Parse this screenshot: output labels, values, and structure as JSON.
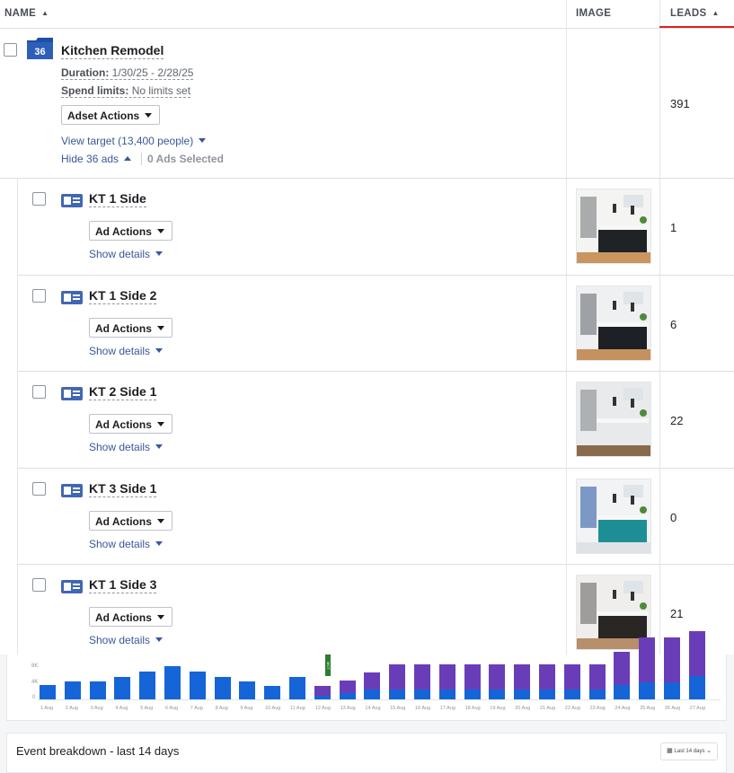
{
  "columns": {
    "name": "NAME",
    "image": "IMAGE",
    "leads": "LEADS"
  },
  "adset": {
    "calendar_day": "36",
    "name": "Kitchen Remodel",
    "duration_label": "Duration:",
    "duration_value": "1/30/25 - 2/28/25",
    "spend_label": "Spend limits:",
    "spend_value": "No limits set",
    "actions_label": "Adset Actions",
    "view_target": "View target (13,400 people)",
    "hide_ads": "Hide 36 ads",
    "selected": "0 Ads Selected",
    "leads": "391"
  },
  "ads": [
    {
      "name": "KT 1 Side",
      "actions_label": "Ad Actions",
      "details_label": "Show details",
      "leads": "1"
    },
    {
      "name": "KT 1 Side 2",
      "actions_label": "Ad Actions",
      "details_label": "Show details",
      "leads": "6"
    },
    {
      "name": "KT 2 Side 1",
      "actions_label": "Ad Actions",
      "details_label": "Show details",
      "leads": "22"
    },
    {
      "name": "KT 3 Side 1",
      "actions_label": "Ad Actions",
      "details_label": "Show details",
      "leads": "0"
    },
    {
      "name": "KT 1 Side 3",
      "actions_label": "Ad Actions",
      "details_label": "Show details",
      "leads": "21"
    }
  ],
  "chart": {
    "colors": {
      "primary": "#1565d8",
      "secondary": "#6a3db8"
    },
    "y_ticks": [
      "8K",
      "4K",
      "0"
    ],
    "x_labels": [
      "1 Aug",
      "2 Aug",
      "3 Aug",
      "4 Aug",
      "5 Aug",
      "6 Aug",
      "7 Aug",
      "8 Aug",
      "9 Aug",
      "10 Aug",
      "11 Aug",
      "12 Aug",
      "13 Aug",
      "14 Aug",
      "15 Aug",
      "16 Aug",
      "17 Aug",
      "18 Aug",
      "19 Aug",
      "20 Aug",
      "21 Aug",
      "22 Aug",
      "23 Aug",
      "24 Aug",
      "25 Aug",
      "26 Aug",
      "27 Aug"
    ],
    "primary_values": [
      0.32,
      0.4,
      0.4,
      0.5,
      0.62,
      0.74,
      0.62,
      0.5,
      0.4,
      0.3,
      0.5,
      0.08,
      0.14,
      0.22,
      0.22,
      0.22,
      0.22,
      0.22,
      0.22,
      0.22,
      0.22,
      0.22,
      0.22,
      0.32,
      0.38,
      0.38,
      0.52
    ],
    "secondary_values": [
      0,
      0,
      0,
      0,
      0,
      0,
      0,
      0,
      0,
      0,
      0,
      0.22,
      0.28,
      0.38,
      0.56,
      0.56,
      0.56,
      0.56,
      0.56,
      0.56,
      0.56,
      0.56,
      0.56,
      0.74,
      1.0,
      1.0,
      1.0
    ]
  },
  "event_breakdown": {
    "title": "Event breakdown - last 14 days",
    "range": "Last 14 days"
  }
}
